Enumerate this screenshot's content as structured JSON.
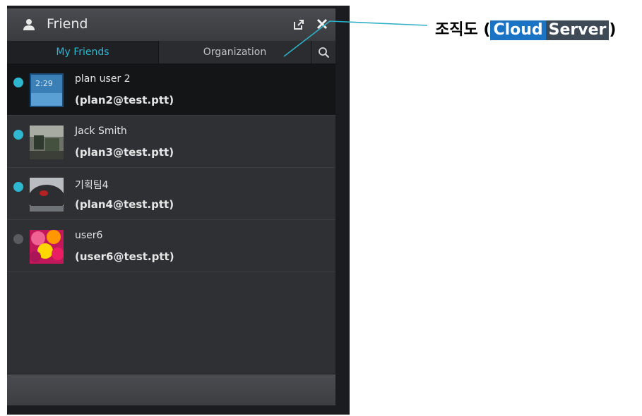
{
  "window": {
    "title": "Friend",
    "icons": [
      "user-icon",
      "popout-icon",
      "close-icon"
    ]
  },
  "tabs": [
    {
      "label": "My Friends",
      "active": true
    },
    {
      "label": "Organization",
      "active": false
    }
  ],
  "search_icon": "search-icon",
  "friends": [
    {
      "name": "plan user 2",
      "email": "(plan2@test.ptt)",
      "online": true,
      "selected": true
    },
    {
      "name": "Jack Smith",
      "email": "(plan3@test.ptt)",
      "online": true,
      "selected": false
    },
    {
      "name": "기획팀4",
      "email": "(plan4@test.ptt)",
      "online": true,
      "selected": false
    },
    {
      "name": "user6",
      "email": "(user6@test.ptt)",
      "online": false,
      "selected": false
    }
  ],
  "annotation": {
    "prefix": "조직도 (",
    "word1": "Cloud",
    "word2": "Server",
    "suffix": ")"
  },
  "colors": {
    "accent": "#2fb7d0",
    "online": "#2fb7d0",
    "offline": "#5a5b60",
    "chip_blue": "#1b73c4",
    "chip_dark": "#3f4a57"
  }
}
